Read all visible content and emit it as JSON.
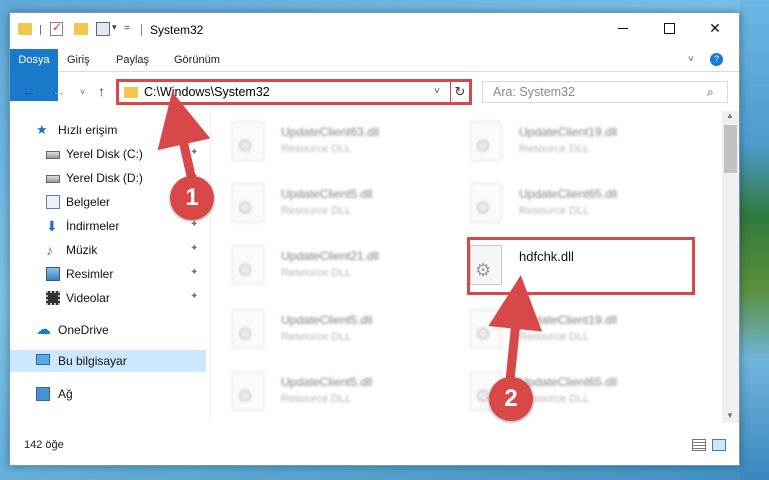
{
  "window": {
    "title": "System32",
    "quick_access_dropdown": "▾",
    "quick_access_overflow": "="
  },
  "ribbon": {
    "tabs": [
      "Dosya",
      "Giriş",
      "Paylaş",
      "Görünüm"
    ],
    "collapse_glyph": "˅",
    "help_glyph": "?"
  },
  "nav": {
    "back_glyph": "←",
    "forward_glyph": "→",
    "recent_glyph": "˅",
    "up_glyph": "↑",
    "address": "C:\\Windows\\System32",
    "address_dropdown_glyph": "˅",
    "refresh_glyph": "↻",
    "search_placeholder": "Ara: System32",
    "search_glyph": "⌕"
  },
  "sidebar": {
    "items": [
      {
        "label": "Hızlı erişim",
        "icon": "star-icon",
        "pinned": false
      },
      {
        "label": "Yerel Disk (C:)",
        "icon": "drive-icon",
        "pinned": true
      },
      {
        "label": "Yerel Disk (D:)",
        "icon": "drive-icon",
        "pinned": true
      },
      {
        "label": "Belgeler",
        "icon": "documents-icon",
        "pinned": true
      },
      {
        "label": "İndirmeler",
        "icon": "downloads-icon",
        "pinned": true
      },
      {
        "label": "Müzik",
        "icon": "music-icon",
        "pinned": true
      },
      {
        "label": "Resimler",
        "icon": "pictures-icon",
        "pinned": true
      },
      {
        "label": "Videolar",
        "icon": "videos-icon",
        "pinned": true
      },
      {
        "label": "OneDrive",
        "icon": "cloud-icon",
        "pinned": false
      },
      {
        "label": "Bu bilgisayar",
        "icon": "computer-icon",
        "pinned": false,
        "selected": true
      },
      {
        "label": "Ağ",
        "icon": "network-icon",
        "pinned": false
      }
    ],
    "pin_glyph": "📌"
  },
  "files": [
    {
      "name": "UpdateClient63.dll",
      "type": "Resource DLL",
      "blurred": true
    },
    {
      "name": "UpdateClient19.dll",
      "type": "Resource DLL",
      "blurred": true
    },
    {
      "name": "UpdateClient5.dll",
      "type": "Resource DLL",
      "blurred": true
    },
    {
      "name": "UpdateClient65.dll",
      "type": "Resource DLL",
      "blurred": true
    },
    {
      "name": "UpdateClient21.dll",
      "type": "Resource DLL",
      "blurred": true
    },
    {
      "name": "hdfchk.dll",
      "type": "",
      "blurred": false,
      "highlighted": true
    },
    {
      "name": "UpdateClient5.dll",
      "type": "Resource DLL",
      "blurred": true
    },
    {
      "name": "UpdateClient19.dll",
      "type": "Resource DLL",
      "blurred": true
    },
    {
      "name": "UpdateClient5.dll",
      "type": "Resource DLL",
      "blurred": true
    },
    {
      "name": "UpdateClient65.dll",
      "type": "Resource DLL",
      "blurred": true
    }
  ],
  "status": {
    "item_count": "142 öğe"
  },
  "annotations": {
    "badge_1": "1",
    "badge_2": "2",
    "color": "#d84848"
  },
  "colors": {
    "accent": "#1979ca",
    "selection": "#cce8ff",
    "highlight_box": "#d84848"
  }
}
